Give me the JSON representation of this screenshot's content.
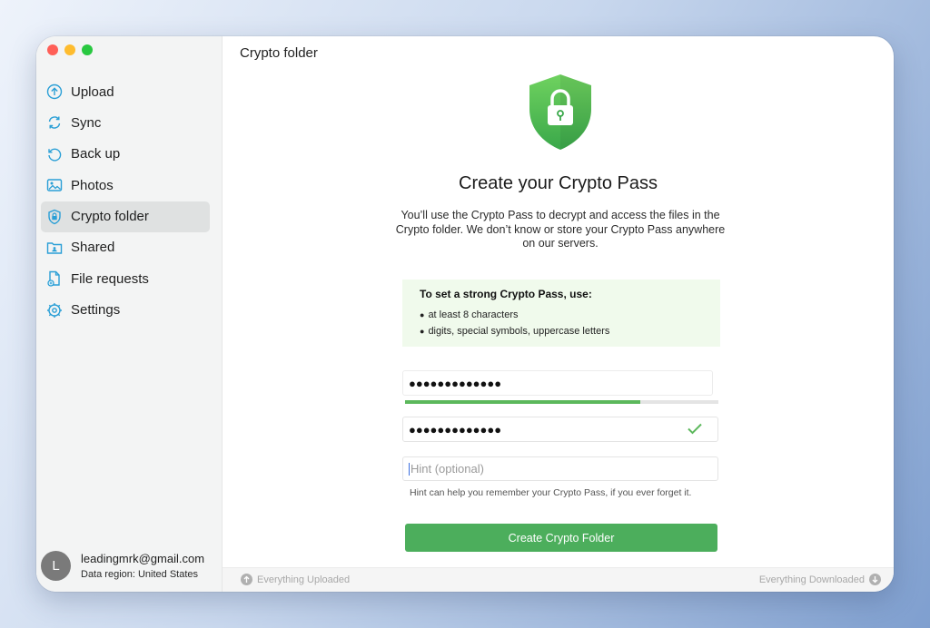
{
  "window": {
    "traffic_lights": {
      "close": "#ff5f57",
      "minimize": "#febc2e",
      "zoom": "#28c840"
    }
  },
  "sidebar": {
    "items": [
      {
        "label": "Upload",
        "icon": "upload-icon"
      },
      {
        "label": "Sync",
        "icon": "sync-icon"
      },
      {
        "label": "Back up",
        "icon": "backup-icon"
      },
      {
        "label": "Photos",
        "icon": "photos-icon"
      },
      {
        "label": "Crypto folder",
        "icon": "crypto-folder-icon",
        "active": true
      },
      {
        "label": "Shared",
        "icon": "shared-icon"
      },
      {
        "label": "File requests",
        "icon": "file-requests-icon"
      },
      {
        "label": "Settings",
        "icon": "settings-icon"
      }
    ],
    "icon_color": "#2a9fd6",
    "account": {
      "avatar_letter": "L",
      "email": "leadingmrk@gmail.com",
      "region": "Data region: United States"
    }
  },
  "main": {
    "title": "Crypto folder",
    "heading": "Create your Crypto Pass",
    "description": "You’ll use the Crypto Pass to decrypt and access the files in the Crypto folder. We don’t know or store your Crypto Pass anywhere on our servers.",
    "tips": {
      "title": "To set a strong Crypto Pass, use:",
      "items": [
        "at least 8 characters",
        "digits, special symbols, uppercase letters"
      ]
    },
    "password": {
      "value": "●●●●●●●●●●●●●"
    },
    "strength": {
      "level": 0.75,
      "color": "#5cb85c"
    },
    "confirm": {
      "value": "●●●●●●●●●●●●●"
    },
    "hint": {
      "placeholder": "Hint (optional)",
      "help": "Hint can help you remember your Crypto Pass, if you ever forget it."
    },
    "create_button": "Create Crypto Folder",
    "accent": "#4cae5c"
  },
  "status": {
    "left": "Everything Uploaded",
    "right": "Everything Downloaded"
  }
}
